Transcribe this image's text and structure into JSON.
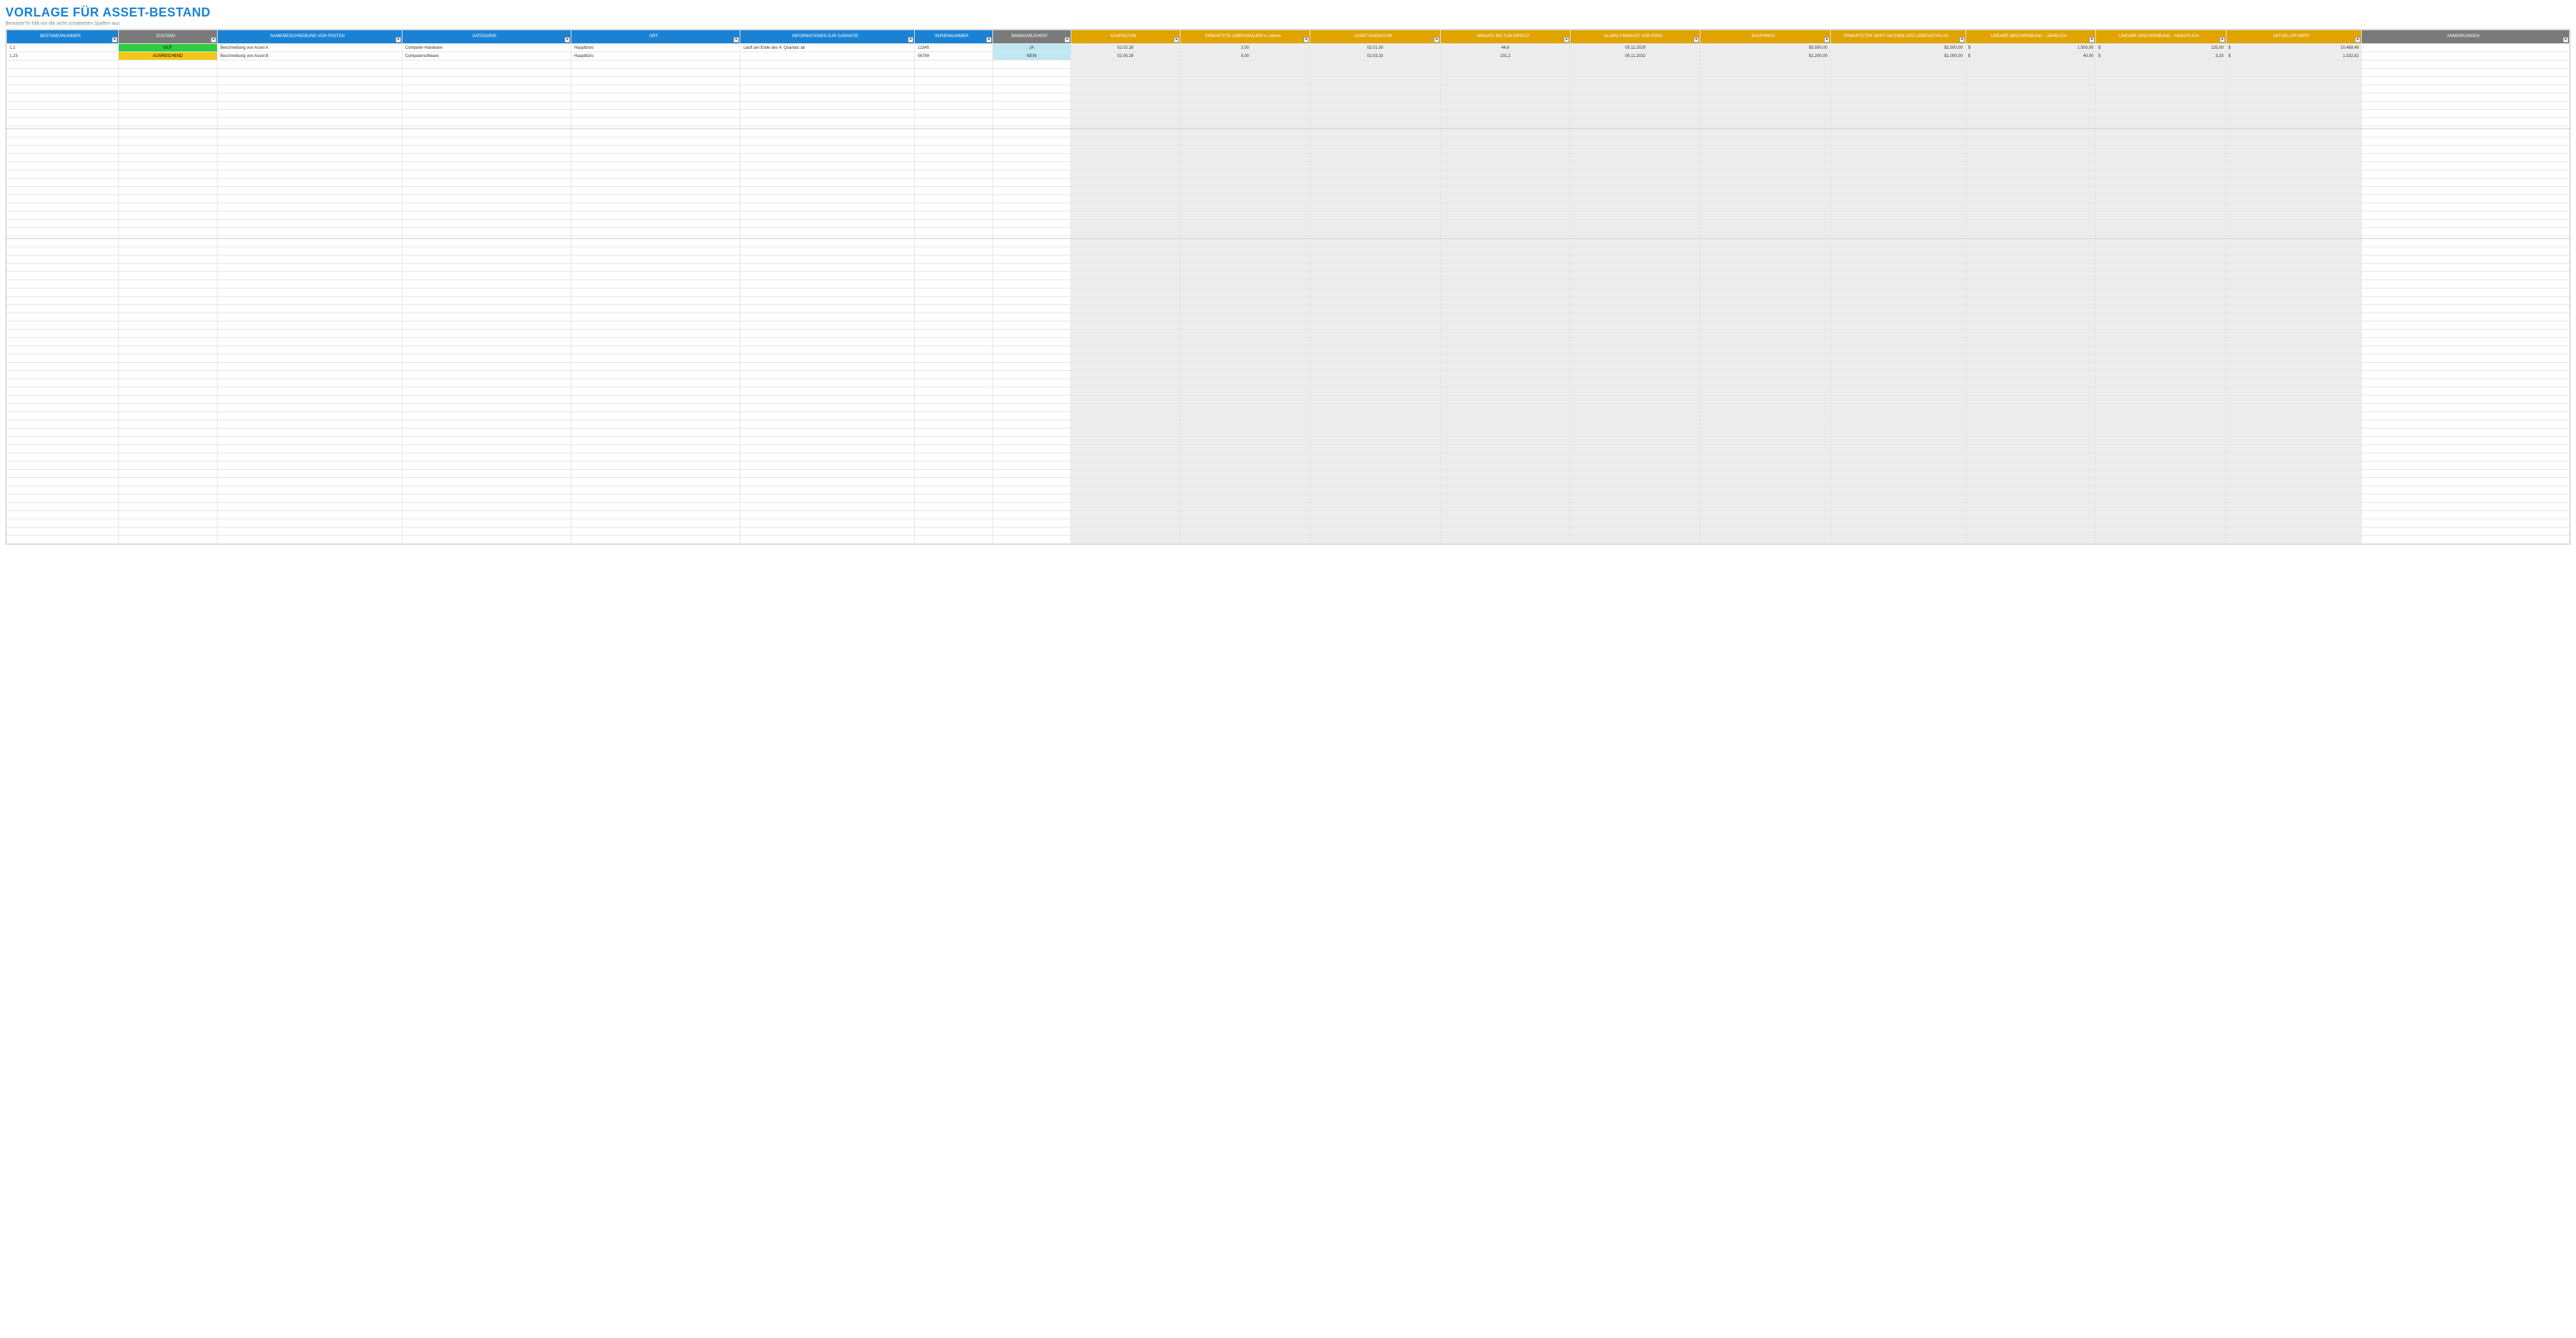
{
  "title": "VORLAGE FÜR ASSET-BESTAND",
  "subtitle": "Benutzer*in füllt nur die nicht schattierten Spalten aus.",
  "headers": [
    {
      "label": "BESTANDSNUMMER",
      "cls": "h-blue"
    },
    {
      "label": "ZUSTAND",
      "cls": "h-gray"
    },
    {
      "label": "NAME/BESCHREIBUNG VON POSTEN",
      "cls": "h-blue"
    },
    {
      "label": "KATEGORIE",
      "cls": "h-blue"
    },
    {
      "label": "ORT",
      "cls": "h-blue"
    },
    {
      "label": "INFORMATIONEN ZUR GARANTIE",
      "cls": "h-blue"
    },
    {
      "label": "SERIENNUMMER",
      "cls": "h-blue"
    },
    {
      "label": "BANKDARLEHEN?",
      "cls": "h-gray"
    },
    {
      "label": "KAUFDATUM",
      "cls": "h-orange"
    },
    {
      "label": "ERWARTETE LEBENSDAUER in Jahren",
      "cls": "h-orange"
    },
    {
      "label": "ASSET-ENDDATUM",
      "cls": "h-orange"
    },
    {
      "label": "MONATE BIS ZUM ERSATZ",
      "cls": "h-orange"
    },
    {
      "label": "ALARM 3 MONATE VOR ENDE",
      "cls": "h-orange"
    },
    {
      "label": "KAUFPREIS",
      "cls": "h-orange"
    },
    {
      "label": "ERWARTETER WERT AM ENDE DES LEBENSZYKLUS",
      "cls": "h-orange"
    },
    {
      "label": "LINEARE ABSCHREIBUNG – JÄHRLICH",
      "cls": "h-orange"
    },
    {
      "label": "LINEARE ABSCHREIBUNG – MONATLICH",
      "cls": "h-orange"
    },
    {
      "label": "AKTUELLER WERT",
      "cls": "h-orange"
    },
    {
      "label": "ANMERKUNGEN",
      "cls": "h-gray"
    }
  ],
  "rows": [
    {
      "id": "1.1",
      "zustand": "GUT",
      "zcls": "badge-green",
      "name": "Beschreibung von Asset A",
      "kat": "Computer-Hardware",
      "ort": "Hauptbüro",
      "garantie": "Läuft am Ende des 4. Quartals ab",
      "serial": "12345",
      "loan": "JA",
      "kauf": "02.02.28",
      "leben": "2,00",
      "ende": "02.01.30",
      "monate": "44,6",
      "alarm": "05.11.2029",
      "preis": "$5.500,00",
      "endwert": "$2.500,00",
      "abj": "1.500,00",
      "abm": "125,00",
      "wert": "10.468,49",
      "anm": ""
    },
    {
      "id": "1.23",
      "zustand": "AUSREICHEND",
      "zcls": "badge-yellow",
      "name": "Beschreibung von Asset B",
      "kat": "Computersoftware",
      "ort": "Hauptbüro",
      "garantie": "",
      "serial": "56789",
      "loan": "NEIN",
      "kauf": "02.05.28",
      "leben": "5,00",
      "ende": "02.03.33",
      "monate": "101,2",
      "alarm": "05.11.2032",
      "preis": "$1.200,00",
      "endwert": "$1.000,00",
      "abj": "40,00",
      "abm": "3,33",
      "wert": "1.332,82",
      "anm": ""
    }
  ],
  "currency": "$",
  "spacerRows": 58,
  "groups": [
    10,
    23
  ]
}
